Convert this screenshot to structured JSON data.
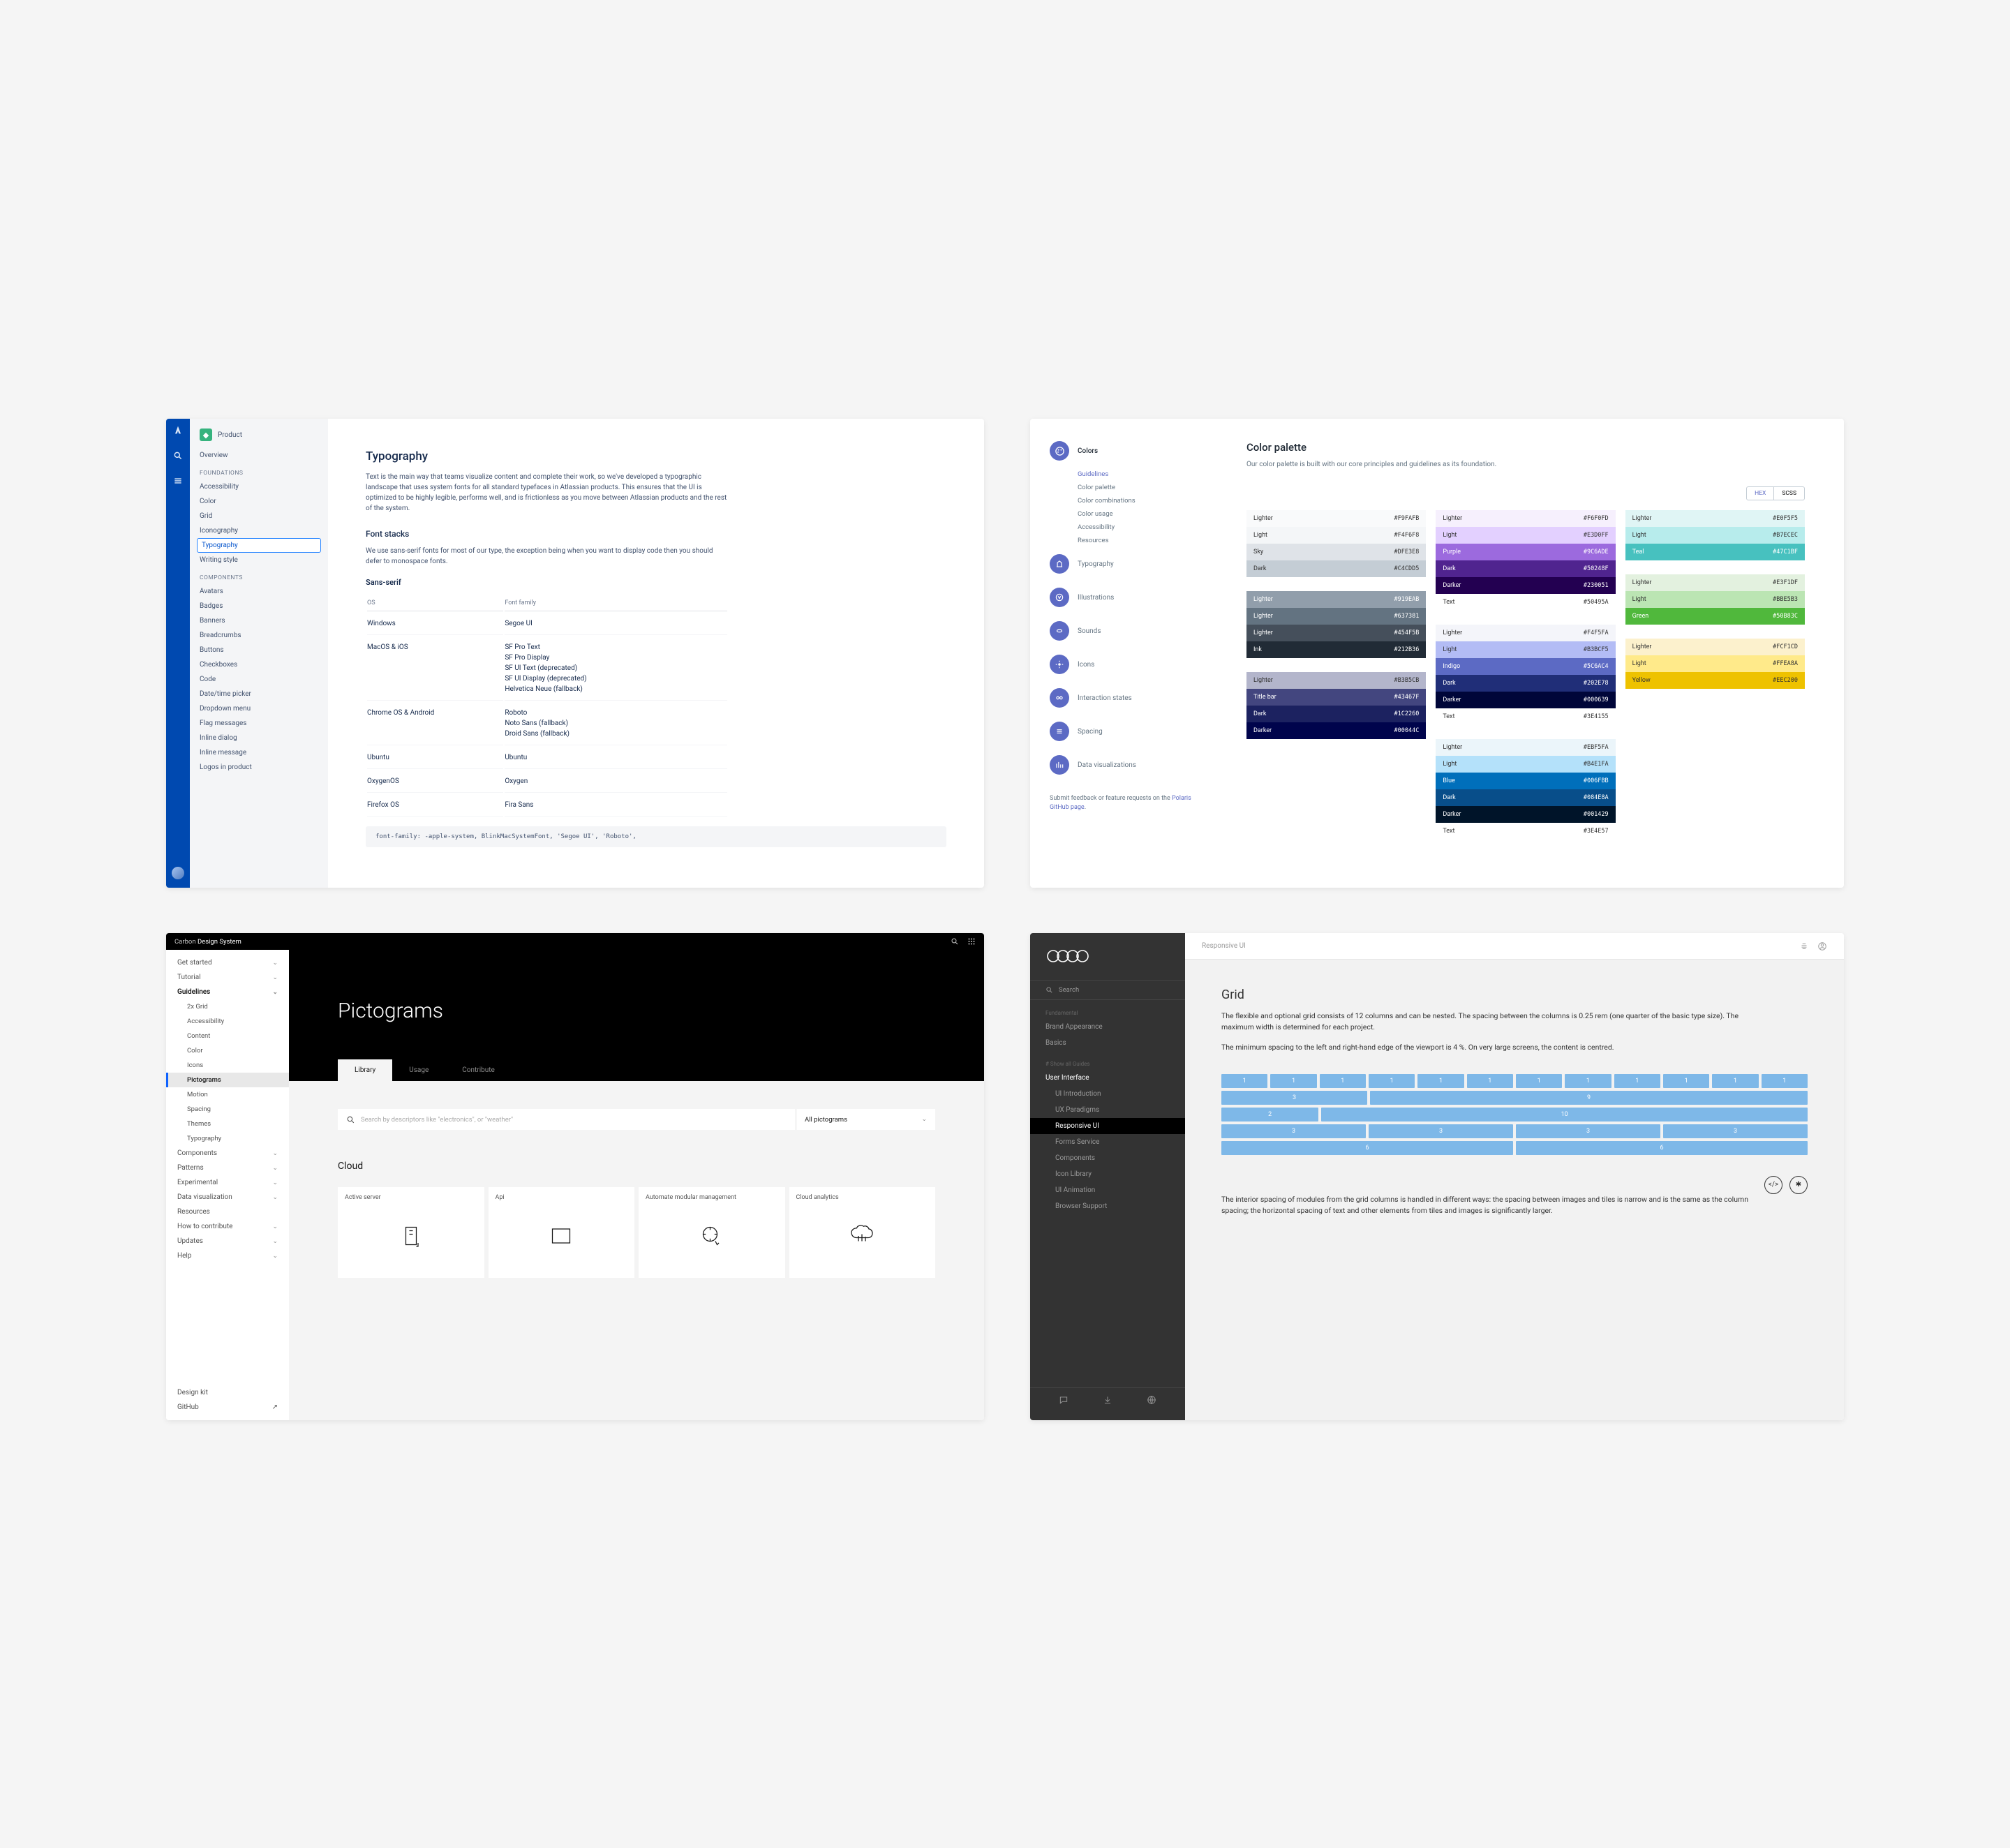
{
  "p1": {
    "product_label": "Product",
    "overview": "Overview",
    "foundations_hdr": "FOUNDATIONS",
    "foundations": [
      "Accessibility",
      "Color",
      "Grid",
      "Iconography",
      "Typography",
      "Writing style"
    ],
    "foundations_selected": 4,
    "components_hdr": "COMPONENTS",
    "components": [
      "Avatars",
      "Badges",
      "Banners",
      "Breadcrumbs",
      "Buttons",
      "Checkboxes",
      "Code",
      "Date/time picker",
      "Dropdown menu",
      "Flag messages",
      "Inline dialog",
      "Inline message",
      "Logos in product"
    ],
    "title": "Typography",
    "intro": "Text is the main way that teams visualize content and complete their work, so we've developed a typographic landscape that uses system fonts for all standard typefaces in Atlassian products. This ensures that the UI is optimized to be highly legible, performs well, and is frictionless as you move between Atlassian products and the rest of the system.",
    "stacks_title": "Font stacks",
    "stacks_body": "We use sans-serif fonts for most of our type, the exception being when you want to display code then you should defer to monospace fonts.",
    "sans_title": "Sans-serif",
    "th_os": "OS",
    "th_ff": "Font family",
    "rows": [
      {
        "os": "Windows",
        "ff": "Segoe UI"
      },
      {
        "os": "MacOS & iOS",
        "ff": "SF Pro Text\nSF Pro Display\nSF UI Text (deprecated)\nSF UI Display (deprecated)\nHelvetica Neue (fallback)"
      },
      {
        "os": "Chrome OS & Android",
        "ff": "Roboto\nNoto Sans (fallback)\nDroid Sans (fallback)"
      },
      {
        "os": "Ubuntu",
        "ff": "Ubuntu"
      },
      {
        "os": "OxygenOS",
        "ff": "Oxygen"
      },
      {
        "os": "Firefox OS",
        "ff": "Fira Sans"
      }
    ],
    "code": "font-family: -apple-system, BlinkMacSystemFont, 'Segoe UI', 'Roboto',"
  },
  "p2": {
    "sidebar_active": "Colors",
    "subs": [
      "Guidelines",
      "Color palette",
      "Color combinations",
      "Color usage",
      "Accessibility",
      "Resources"
    ],
    "sub_on": 0,
    "cats": [
      "Typography",
      "Illustrations",
      "Sounds",
      "Icons",
      "Interaction states",
      "Spacing",
      "Data visualizations"
    ],
    "feedback_1": "Submit feedback or feature requests on the ",
    "feedback_link": "Polaris GitHub page",
    "feedback_2": ".",
    "title": "Color palette",
    "desc": "Our color palette is built with our core principles and guidelines as its foundation.",
    "toggle_hex": "HEX",
    "toggle_scss": "SCSS",
    "groups": [
      [
        {
          "n": "Lighter",
          "h": "#F9FAFB",
          "bg": "#F9FAFB",
          "fg": "#333"
        },
        {
          "n": "Light",
          "h": "#F4F6F8",
          "bg": "#F4F6F8",
          "fg": "#333"
        },
        {
          "n": "Sky",
          "h": "#DFE3E8",
          "bg": "#DFE3E8",
          "fg": "#333"
        },
        {
          "n": "Dark",
          "h": "#C4CDD5",
          "bg": "#C4CDD5",
          "fg": "#333"
        }
      ],
      [
        {
          "n": "Lighter",
          "h": "#F6F0FD",
          "bg": "#F6F0FD",
          "fg": "#333"
        },
        {
          "n": "Light",
          "h": "#E3D0FF",
          "bg": "#E3D0FF",
          "fg": "#333"
        },
        {
          "n": "Purple",
          "h": "#9C6ADE",
          "bg": "#9C6ADE",
          "fg": "#fff"
        },
        {
          "n": "Dark",
          "h": "#50248F",
          "bg": "#50248F",
          "fg": "#fff"
        },
        {
          "n": "Darker",
          "h": "#230051",
          "bg": "#230051",
          "fg": "#fff"
        },
        {
          "n": "Text",
          "h": "#50495A",
          "bg": "#fff",
          "fg": "#333"
        }
      ],
      [
        {
          "n": "Lighter",
          "h": "#E0F5F5",
          "bg": "#E0F5F5",
          "fg": "#333"
        },
        {
          "n": "Light",
          "h": "#B7ECEC",
          "bg": "#B7ECEC",
          "fg": "#333"
        },
        {
          "n": "Teal",
          "h": "#47C1BF",
          "bg": "#47C1BF",
          "fg": "#fff"
        }
      ],
      [
        {
          "n": "Lighter",
          "h": "#919EAB",
          "bg": "#919EAB",
          "fg": "#fff"
        },
        {
          "n": "Lighter",
          "h": "#637381",
          "bg": "#637381",
          "fg": "#fff"
        },
        {
          "n": "Lighter",
          "h": "#454F5B",
          "bg": "#454F5B",
          "fg": "#fff"
        },
        {
          "n": "Ink",
          "h": "#212B36",
          "bg": "#212B36",
          "fg": "#fff"
        }
      ],
      [
        {
          "n": "Lighter",
          "h": "#F4F5FA",
          "bg": "#F4F5FA",
          "fg": "#333"
        },
        {
          "n": "Light",
          "h": "#B3BCF5",
          "bg": "#B3BCF5",
          "fg": "#333"
        },
        {
          "n": "Indigo",
          "h": "#5C6AC4",
          "bg": "#5C6AC4",
          "fg": "#fff"
        },
        {
          "n": "Dark",
          "h": "#202E78",
          "bg": "#202E78",
          "fg": "#fff"
        },
        {
          "n": "Darker",
          "h": "#000639",
          "bg": "#000639",
          "fg": "#fff"
        },
        {
          "n": "Text",
          "h": "#3E4155",
          "bg": "#fff",
          "fg": "#333"
        }
      ],
      [
        {
          "n": "Lighter",
          "h": "#E3F1DF",
          "bg": "#E3F1DF",
          "fg": "#333"
        },
        {
          "n": "Light",
          "h": "#BBE5B3",
          "bg": "#BBE5B3",
          "fg": "#333"
        },
        {
          "n": "Green",
          "h": "#50B83C",
          "bg": "#50B83C",
          "fg": "#fff"
        }
      ],
      [
        {
          "n": "Lighter",
          "h": "#B3B5CB",
          "bg": "#B3B5CB",
          "fg": "#333"
        },
        {
          "n": "Title bar",
          "h": "#43467F",
          "bg": "#43467F",
          "fg": "#fff"
        },
        {
          "n": "Dark",
          "h": "#1C2260",
          "bg": "#1C2260",
          "fg": "#fff"
        },
        {
          "n": "Darker",
          "h": "#00044C",
          "bg": "#00044C",
          "fg": "#fff"
        }
      ],
      [
        {
          "n": "Lighter",
          "h": "#EBF5FA",
          "bg": "#EBF5FA",
          "fg": "#333"
        },
        {
          "n": "Light",
          "h": "#B4E1FA",
          "bg": "#B4E1FA",
          "fg": "#333"
        },
        {
          "n": "Blue",
          "h": "#006FBB",
          "bg": "#006FBB",
          "fg": "#fff"
        },
        {
          "n": "Dark",
          "h": "#084E8A",
          "bg": "#084E8A",
          "fg": "#fff"
        },
        {
          "n": "Darker",
          "h": "#001429",
          "bg": "#001429",
          "fg": "#fff"
        },
        {
          "n": "Text",
          "h": "#3E4E57",
          "bg": "#fff",
          "fg": "#333"
        }
      ],
      [
        {
          "n": "Lighter",
          "h": "#FCF1CD",
          "bg": "#FCF1CD",
          "fg": "#333"
        },
        {
          "n": "Light",
          "h": "#FFEA8A",
          "bg": "#FFEA8A",
          "fg": "#333"
        },
        {
          "n": "Yellow",
          "h": "#EEC200",
          "bg": "#EEC200",
          "fg": "#333"
        }
      ]
    ]
  },
  "p3": {
    "brand_1": "Carbon",
    "brand_2": "Design System",
    "side": [
      {
        "l": "Get started",
        "c": true
      },
      {
        "l": "Tutorial",
        "c": true
      },
      {
        "l": "Guidelines",
        "c": true,
        "open": true
      },
      {
        "l": "2x Grid",
        "sub": true
      },
      {
        "l": "Accessibility",
        "sub": true
      },
      {
        "l": "Content",
        "sub": true
      },
      {
        "l": "Color",
        "sub": true
      },
      {
        "l": "Icons",
        "sub": true
      },
      {
        "l": "Pictograms",
        "sub": true,
        "sel": true
      },
      {
        "l": "Motion",
        "sub": true
      },
      {
        "l": "Spacing",
        "sub": true
      },
      {
        "l": "Themes",
        "sub": true
      },
      {
        "l": "Typography",
        "sub": true
      },
      {
        "l": "Components",
        "c": true
      },
      {
        "l": "Patterns",
        "c": true
      },
      {
        "l": "Experimental",
        "c": true
      },
      {
        "l": "Data visualization",
        "c": true
      },
      {
        "l": "Resources"
      },
      {
        "l": "How to contribute",
        "c": true
      },
      {
        "l": "Updates",
        "c": true
      },
      {
        "l": "Help",
        "c": true
      }
    ],
    "side_bottom": [
      {
        "l": "Design kit"
      },
      {
        "l": "GitHub",
        "ext": true
      }
    ],
    "title": "Pictograms",
    "tabs": [
      "Library",
      "Usage",
      "Contribute"
    ],
    "tab_on": 0,
    "search_ph": "Search by descriptors like \"electronics\", or \"weather\"",
    "select_val": "All pictograms",
    "section": "Cloud",
    "cards": [
      "Active server",
      "Api",
      "Automate modular management",
      "Cloud analytics"
    ]
  },
  "p4": {
    "search": "Search",
    "hdr1": "Fundamental",
    "nav1": [
      "Brand Appearance",
      "Basics"
    ],
    "hdr2": "# Show all Guides",
    "nav2_head": "User Interface",
    "nav2": [
      "UI Introduction",
      "UX Paradigms",
      "Responsive UI",
      "Forms Service",
      "Components",
      "Icon Library",
      "UI Animation",
      "Browser Support"
    ],
    "nav2_on": 2,
    "crumb": "Responsive UI",
    "title": "Grid",
    "para1": "The flexible and optional grid consists of 12 columns and can be nested. The spacing between the columns is 0.25 rem (one quarter of the basic type size). The maximum width is determined for each project.",
    "para2": "The minimum spacing to the left and right-hand edge of the viewport is 4 %. On very large screens, the content is centred.",
    "gridrows": [
      [
        1,
        1,
        1,
        1,
        1,
        1,
        1,
        1,
        1,
        1,
        1,
        1
      ],
      [
        3,
        9
      ],
      [
        2,
        10
      ],
      [
        3,
        3,
        3,
        3
      ],
      [
        6,
        6
      ]
    ],
    "para3": "The interior spacing of modules from the grid columns is handled in different ways: the spacing between images and tiles is narrow and is the same as the column spacing; the horizontal spacing of text and other elements from tiles and images is significantly larger."
  }
}
